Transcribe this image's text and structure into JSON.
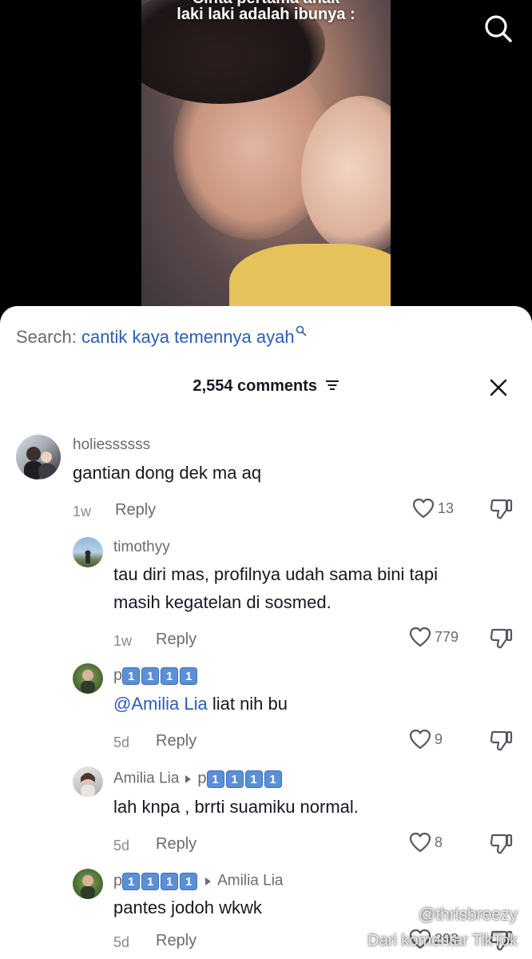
{
  "video": {
    "caption_line1": "Cinta pertama anak",
    "caption_line2": "laki laki adalah ibunya :"
  },
  "search": {
    "label": "Search:",
    "query": "cantik kaya temennya ayah"
  },
  "comments_header": {
    "count_text": "2,554 comments"
  },
  "comments": [
    {
      "username": "holiessssss",
      "text": "gantian dong dek ma aq",
      "time": "1w",
      "reply_label": "Reply",
      "likes": "13"
    },
    {
      "username": "timothyy",
      "text_line1": "tau diri mas, profilnya udah sama bini tapi",
      "text_line2": "masih kegatelan di sosmed.",
      "time": "1w",
      "reply_label": "Reply",
      "likes": "779"
    },
    {
      "username_prefix": "p",
      "badges": [
        "1",
        "1",
        "1",
        "1"
      ],
      "mention": "@Amilia Lia",
      "text": "liat nih bu",
      "time": "5d",
      "reply_label": "Reply",
      "likes": "9"
    },
    {
      "username": "Amilia Lia",
      "reply_to_prefix": "p",
      "reply_to_badges": [
        "1",
        "1",
        "1",
        "1"
      ],
      "text": "lah knpa , brrti suamiku normal.",
      "time": "5d",
      "reply_label": "Reply",
      "likes": "8"
    },
    {
      "username_prefix": "p",
      "badges": [
        "1",
        "1",
        "1",
        "1"
      ],
      "reply_to": "Amilia Lia",
      "text": "pantes jodoh wkwk",
      "time": "5d",
      "reply_label": "Reply",
      "likes": "293"
    }
  ],
  "watermark": {
    "handle": "@thrisbreezy",
    "source": "Dari komentar TikTok"
  },
  "icons": {
    "search": "search-icon",
    "close": "close-icon",
    "filter": "filter-icon",
    "like": "heart-icon",
    "dislike": "dislike-icon"
  },
  "colors": {
    "link": "#2b5db5",
    "muted": "#6a6b72",
    "badge": "#5b8fd6"
  }
}
